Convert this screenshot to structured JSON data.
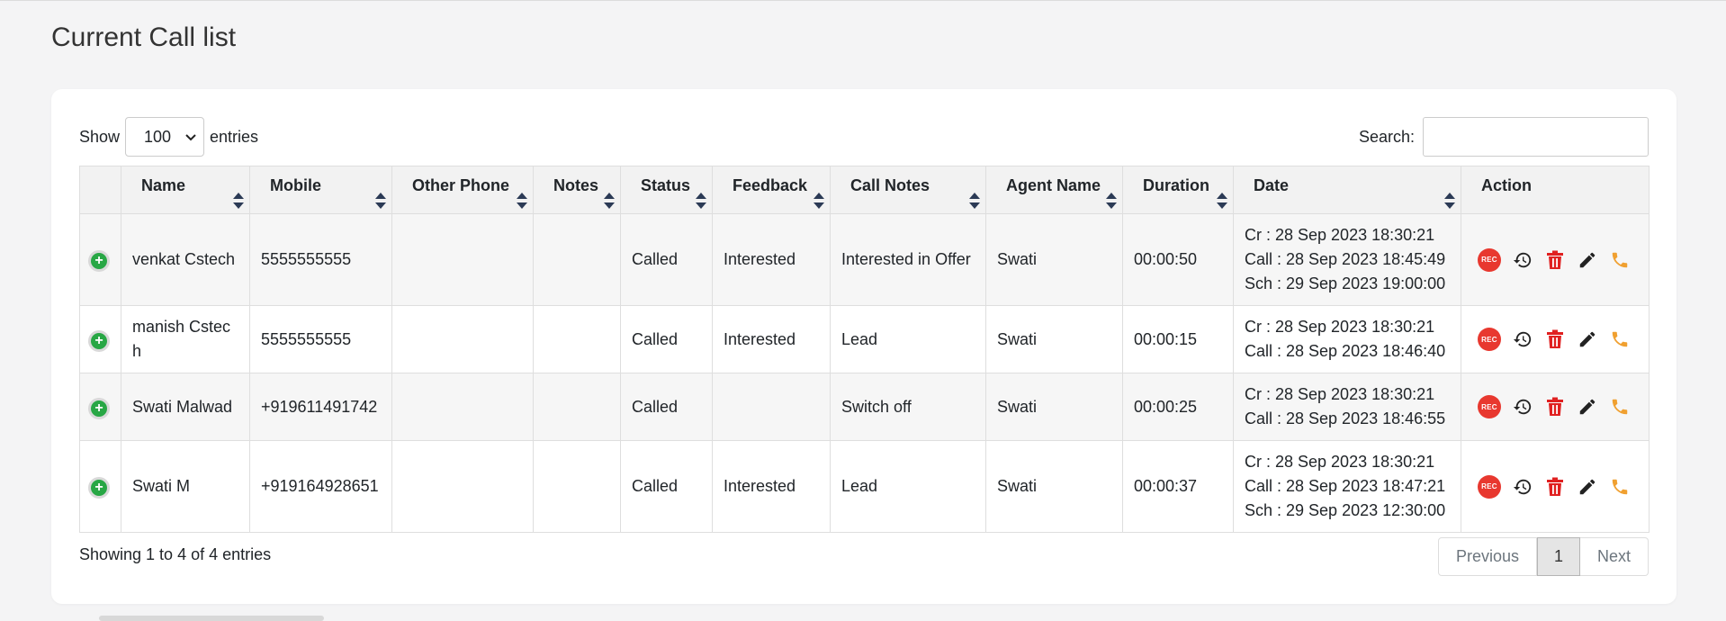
{
  "page": {
    "title": "Current Call list"
  },
  "length_menu": {
    "show_label": "Show",
    "value": "100",
    "entries_label": "entries"
  },
  "search": {
    "label": "Search:",
    "value": ""
  },
  "table": {
    "columns": [
      "",
      "Name",
      "Mobile",
      "Other Phone",
      "Notes",
      "Status",
      "Feedback",
      "Call Notes",
      "Agent Name",
      "Duration",
      "Date",
      "Action"
    ],
    "rows": [
      {
        "name": "venkat Cstech",
        "mobile": "5555555555",
        "other_phone": "",
        "notes": "",
        "status": "Called",
        "feedback": "Interested",
        "call_notes": "Interested in Offer",
        "agent": "Swati",
        "duration": "00:00:50",
        "date": [
          "Cr : 28 Sep 2023 18:30:21",
          "Call : 28 Sep 2023 18:45:49",
          "Sch : 29 Sep 2023 19:00:00"
        ]
      },
      {
        "name": "manish Cstec h",
        "mobile": "5555555555",
        "other_phone": "",
        "notes": "",
        "status": "Called",
        "feedback": "Interested",
        "call_notes": "Lead",
        "agent": "Swati",
        "duration": "00:00:15",
        "date": [
          "Cr : 28 Sep 2023 18:30:21",
          "Call : 28 Sep 2023 18:46:40",
          ""
        ]
      },
      {
        "name": "Swati Malwad",
        "mobile": "+919611491742",
        "other_phone": "",
        "notes": "",
        "status": "Called",
        "feedback": "",
        "call_notes": "Switch off",
        "agent": "Swati",
        "duration": "00:00:25",
        "date": [
          "Cr : 28 Sep 2023 18:30:21",
          "Call : 28 Sep 2023 18:46:55",
          ""
        ]
      },
      {
        "name": "Swati M",
        "mobile": "+919164928651",
        "other_phone": "",
        "notes": "",
        "status": "Called",
        "feedback": "Interested",
        "call_notes": "Lead",
        "agent": "Swati",
        "duration": "00:00:37",
        "date": [
          "Cr : 28 Sep 2023 18:30:21",
          "Call : 28 Sep 2023 18:47:21",
          "Sch : 29 Sep 2023 12:30:00"
        ]
      }
    ],
    "action_icons": [
      "rec-icon",
      "history-icon",
      "trash-icon",
      "pencil-icon",
      "phone-icon"
    ],
    "rec_label": "REC"
  },
  "footer": {
    "info": "Showing 1 to 4 of 4 entries",
    "prev": "Previous",
    "page": "1",
    "next": "Next"
  },
  "colors": {
    "rec": "#e8382f",
    "trash": "#e02020",
    "phone": "#f0a030",
    "icon_dark": "#222222",
    "expand": "#28a745"
  }
}
